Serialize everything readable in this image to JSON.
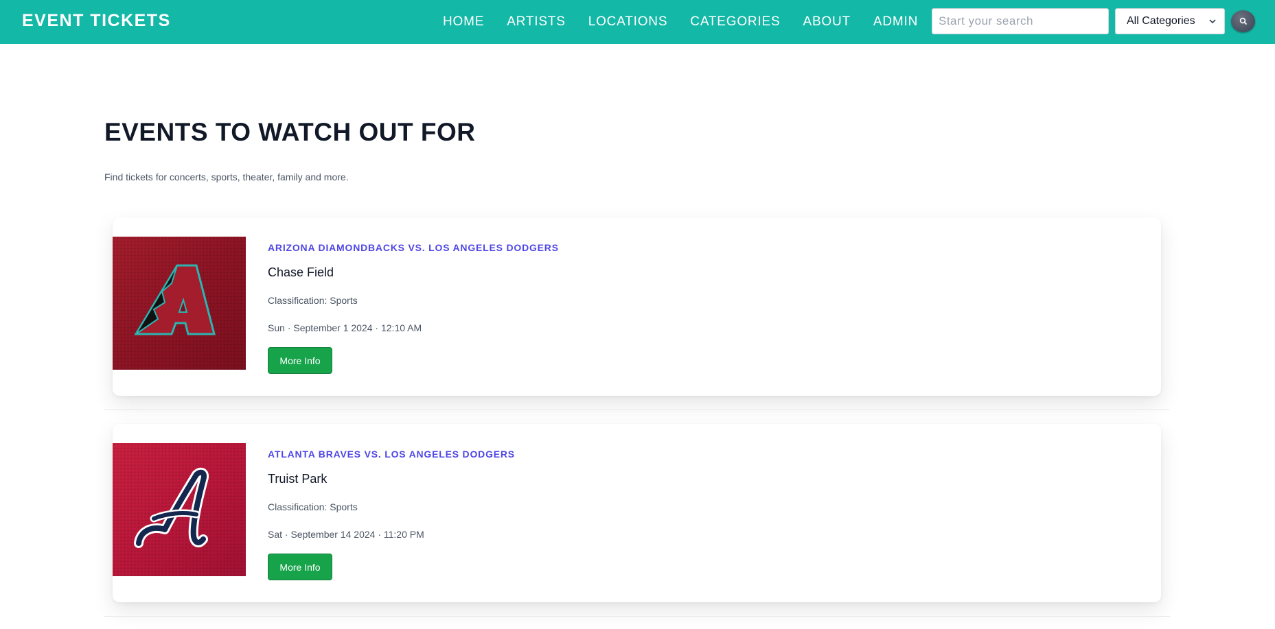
{
  "header": {
    "brand": "EVENT TICKETS",
    "nav": [
      "HOME",
      "ARTISTS",
      "LOCATIONS",
      "CATEGORIES",
      "ABOUT",
      "ADMIN"
    ],
    "search_placeholder": "Start your search",
    "category_selected": "All Categories",
    "search_button_icon": "search-icon"
  },
  "main": {
    "title": "EVENTS TO WATCH OUT FOR",
    "subtitle": "Find tickets for concerts, sports, theater, family and more.",
    "events": [
      {
        "title": "ARIZONA DIAMONDBACKS VS. LOS ANGELES DODGERS",
        "venue": "Chase Field",
        "classification": "Classification: Sports",
        "datetime": "Sun · September 1 2024 · 12:10 AM",
        "button": "More Info",
        "image": "arizona-diamondbacks-logo"
      },
      {
        "title": "ATLANTA BRAVES VS. LOS ANGELES DODGERS",
        "venue": "Truist Park",
        "classification": "Classification: Sports",
        "datetime": "Sat · September 14 2024 · 11:20 PM",
        "button": "More Info",
        "image": "atlanta-braves-logo"
      }
    ]
  },
  "colors": {
    "header_bg": "#14b8a6",
    "event_title": "#4f46e5",
    "button_bg": "#16a34a"
  }
}
